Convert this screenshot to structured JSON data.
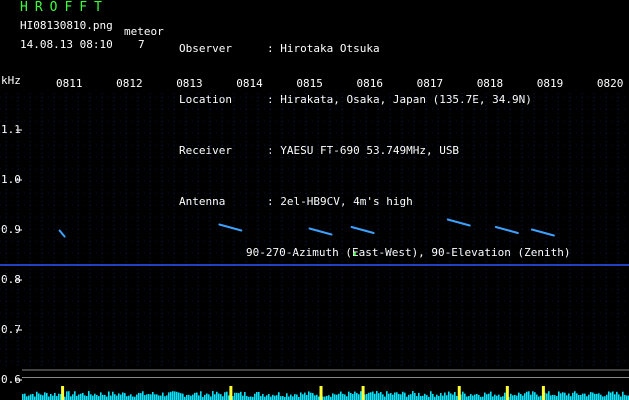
{
  "header": {
    "brand": "HROFFT",
    "filename": "HI08130810.png",
    "datetime": "14.08.13 08:10",
    "meteor_label": "meteor",
    "meteor_count": "7"
  },
  "info": {
    "rows": [
      {
        "key": "Observer",
        "value": "Hirotaka Otsuka"
      },
      {
        "key": "Location",
        "value": "Hirakata, Osaka, Japan (135.7E, 34.9N)"
      },
      {
        "key": "Receiver",
        "value": "YAESU FT-690 53.749MHz, USB"
      },
      {
        "key": "Antenna",
        "value": "2el-HB9CV, 4m's high"
      }
    ],
    "antenna_extra": "90-270-Azimuth (East-West), 90-Elevation (Zenith)"
  },
  "spectrogram": {
    "freq_unit": "kHz",
    "freq_labels": [
      "1.1",
      "1.0",
      "0.9",
      "0.8",
      "0.7",
      "0.6"
    ],
    "freq_values": [
      1.1,
      1.0,
      0.9,
      0.8,
      0.7,
      0.6
    ],
    "freq_range_khz": [
      0.58,
      1.17
    ],
    "time_labels": [
      "0811",
      "0812",
      "0813",
      "0814",
      "0815",
      "0816",
      "0817",
      "0818",
      "0819",
      "0820"
    ],
    "time_range_min": [
      0,
      10
    ],
    "carrier_khz": 0.83,
    "meteor_echoes": [
      {
        "t": 0.9,
        "f": 0.893
      },
      {
        "t": 3.7,
        "f": 0.905
      },
      {
        "t": 5.2,
        "f": 0.897
      },
      {
        "t": 5.9,
        "f": 0.9
      },
      {
        "t": 7.5,
        "f": 0.915
      },
      {
        "t": 8.3,
        "f": 0.9
      },
      {
        "t": 8.9,
        "f": 0.895
      }
    ],
    "colors": {
      "background": "#000000",
      "grid": "#1a2a8a",
      "carrier": "#2a55ff",
      "echo": "#3ea0ff",
      "text": "#ffffff",
      "brand": "#3cff3c",
      "power_bars": "#00e6ff",
      "power_peaks": "#ffff33"
    }
  }
}
